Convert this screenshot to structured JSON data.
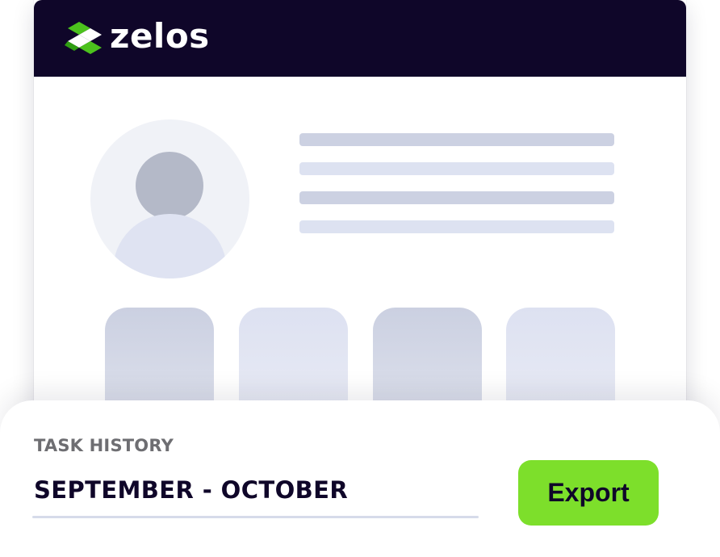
{
  "app": {
    "brand_name": "zelos",
    "brand_icon": "zelos-logo-icon",
    "header_color": "#0f0629"
  },
  "profile": {
    "avatar_icon": "user-avatar-icon",
    "placeholder_line_count": 4,
    "placeholder_tile_count": 4
  },
  "export_panel": {
    "label": "TASK HISTORY",
    "value": "SEPTEMBER - OCTOBER",
    "button_label": "Export",
    "button_color": "#7ddf2b"
  }
}
